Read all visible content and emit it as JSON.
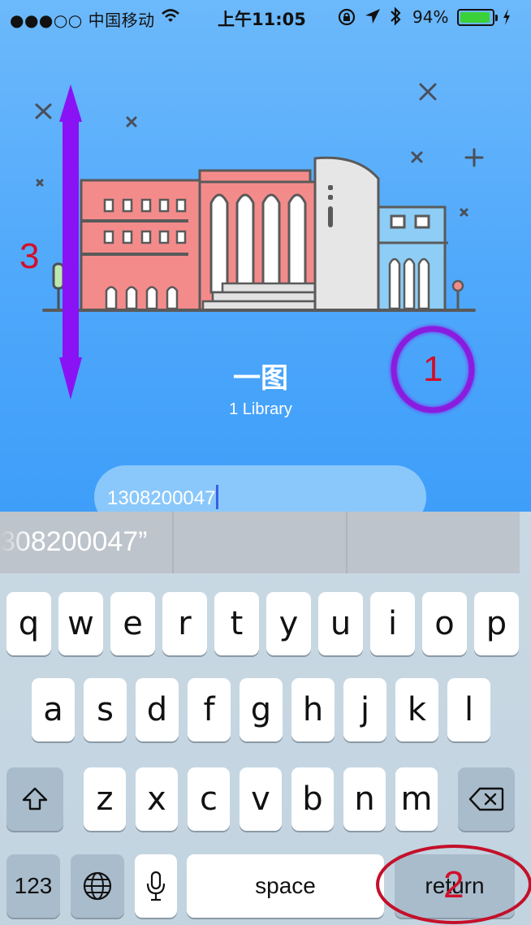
{
  "status_bar": {
    "carrier": "●●●○○ 中国移动",
    "time": "上午11:05",
    "battery_percent": "94%",
    "battery_level": 0.94
  },
  "app": {
    "title": "一图",
    "subtitle": "1 Library",
    "phone_input_value": "1308200047"
  },
  "keyboard": {
    "suggestion_text": "308200047”",
    "row1": [
      "q",
      "w",
      "e",
      "r",
      "t",
      "y",
      "u",
      "i",
      "o",
      "p"
    ],
    "row2": [
      "a",
      "s",
      "d",
      "f",
      "g",
      "h",
      "j",
      "k",
      "l"
    ],
    "row3": [
      "z",
      "x",
      "c",
      "v",
      "b",
      "n",
      "m"
    ],
    "numbers_label": "123",
    "space_label": "space",
    "return_label": "return"
  },
  "annotations": {
    "circle_label": "1",
    "return_mark_label": "2",
    "arrow_label": "3",
    "circle_color": "#8a1fe0",
    "arrow_color": "#8a13f5",
    "label_color": "#d0102a"
  },
  "colors": {
    "background_top": "#6cb9fb",
    "background_bottom": "#3e9ef9",
    "input_fill": "#8ac8fb"
  }
}
